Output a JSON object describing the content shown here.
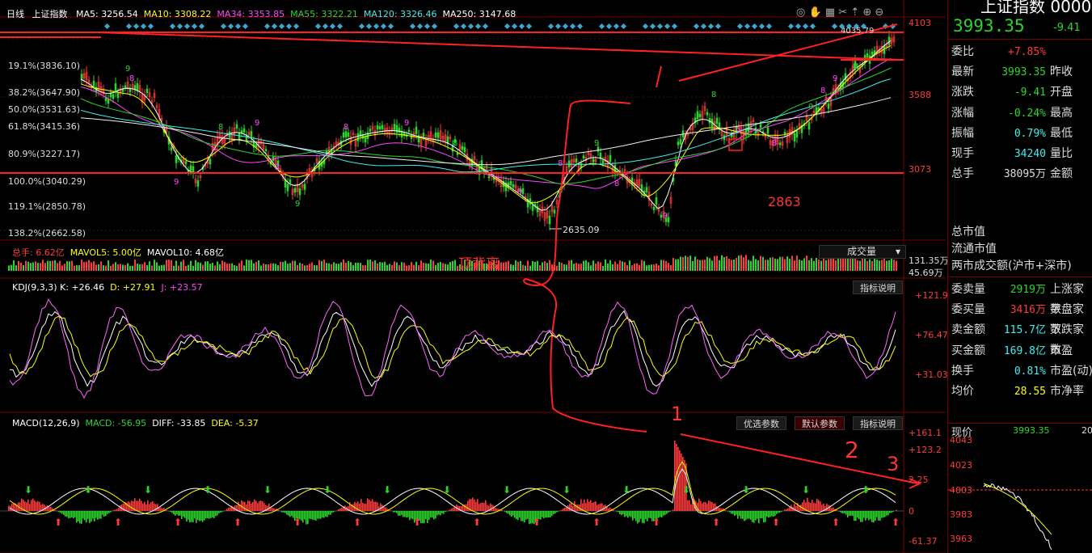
{
  "window": {
    "period_label": "日线",
    "symbol_label": "上证指数"
  },
  "ma_header": [
    {
      "text": "MA5: 3256.54",
      "color": "#ffffff"
    },
    {
      "text": "MA10: 3308.22",
      "color": "#ffff00"
    },
    {
      "text": "MA34: 3353.85",
      "color": "#ff44ff"
    },
    {
      "text": "MA55: 3322.21",
      "color": "#2bd62b"
    },
    {
      "text": "MA120: 3326.46",
      "color": "#3eeeee"
    },
    {
      "text": "MA250: 3147.68",
      "color": "#ffffff"
    }
  ],
  "price_axis": [
    "4103",
    "3588",
    "3073"
  ],
  "fib_labels": [
    "19.1%(3836.10)",
    "38.2%(3647.90)",
    "50.0%(3531.63)",
    "61.8%(3415.36)",
    "80.9%(3227.17)",
    "100.0%(3040.29)",
    "119.1%(2850.78)",
    "138.2%(2662.58)"
  ],
  "chart_notes": {
    "low_value": "2635.09",
    "high_value": "4035.79",
    "low_2863": "2863",
    "top_divergence": "顶背离"
  },
  "volume": {
    "header": [
      {
        "text": "总手: 6.62亿",
        "color": "#ff3b3b"
      },
      {
        "text": "MAVOL5: 5.00亿",
        "color": "#ffff00"
      },
      {
        "text": "MAVOL10: 4.68亿",
        "color": "#ffffff"
      }
    ],
    "selector_label": "成交量",
    "axis": [
      "131.35万",
      "45.69万"
    ]
  },
  "kdj": {
    "header": [
      {
        "text": "KDJ(9,3,3) K: +26.46",
        "color": "#ffffff"
      },
      {
        "text": "D: +27.91",
        "color": "#ffff00"
      },
      {
        "text": "J: +23.57",
        "color": "#ff44ff"
      }
    ],
    "help_label": "指标说明",
    "axis": [
      "+121.9",
      "+76.47",
      "+31.03"
    ]
  },
  "macd": {
    "header": [
      {
        "text": "MACD(12,26,9)",
        "color": "#ffffff"
      },
      {
        "text": "MACD: -56.95",
        "color": "#2bd62b"
      },
      {
        "text": "DIFF: -33.85",
        "color": "#ffffff"
      },
      {
        "text": "DEA: -5.37",
        "color": "#ffff00"
      }
    ],
    "buttons": [
      "优选参数",
      "默认参数",
      "指标说明"
    ],
    "axis": [
      "+161.1",
      "+123.2",
      "2.25",
      "0",
      "-61.37"
    ],
    "annotations": [
      "1",
      "2",
      "3"
    ]
  },
  "right_panel": {
    "title": "上证指数 0000",
    "price": "3993.35",
    "change": "-9.41",
    "rows": [
      {
        "k": "委比",
        "v": "+7.85%",
        "vc": "#ff3b3b",
        "k2": ""
      },
      {
        "k": "最新",
        "v": "3993.35",
        "vc": "#2bd62b",
        "k2": "昨收"
      },
      {
        "k": "涨跌",
        "v": "-9.41",
        "vc": "#2bd62b",
        "k2": "开盘"
      },
      {
        "k": "涨幅",
        "v": "-0.24%",
        "vc": "#2bd62b",
        "k2": "最高"
      },
      {
        "k": "振幅",
        "v": "0.79%",
        "vc": "#3eeeee",
        "k2": "最低"
      },
      {
        "k": "现手",
        "v": "34240",
        "vc": "#3eeeee",
        "k2": "量比"
      },
      {
        "k": "总手",
        "v": "38095万",
        "vc": "#dddddd",
        "k2": "金额"
      }
    ],
    "plain_rows": [
      "总市值",
      "流通市值",
      "两市成交额(沪市+深市)"
    ],
    "rows2": [
      {
        "k": "委卖量",
        "v": "2919万",
        "vc": "#2bd62b",
        "k2": "上涨家数"
      },
      {
        "k": "委买量",
        "v": "3416万",
        "vc": "#ff3b3b",
        "k2": "平盘家数"
      },
      {
        "k": "卖金额",
        "v": "115.7亿",
        "vc": "#3eeeee",
        "k2": "下跌家数"
      },
      {
        "k": "买金额",
        "v": "169.8亿",
        "vc": "#3eeeee",
        "k2": "市盈"
      },
      {
        "k": "换手",
        "v": "0.81%",
        "vc": "#3eeeee",
        "k2": "市盈(动)"
      },
      {
        "k": "均价",
        "v": "28.55",
        "vc": "#ffff00",
        "k2": "市净率"
      }
    ],
    "mini_chart": {
      "header_label": "现价",
      "header_value": "3993.35",
      "header_extra": "20",
      "axis": [
        "4043",
        "4023",
        "4003",
        "3983",
        "3963"
      ]
    }
  }
}
